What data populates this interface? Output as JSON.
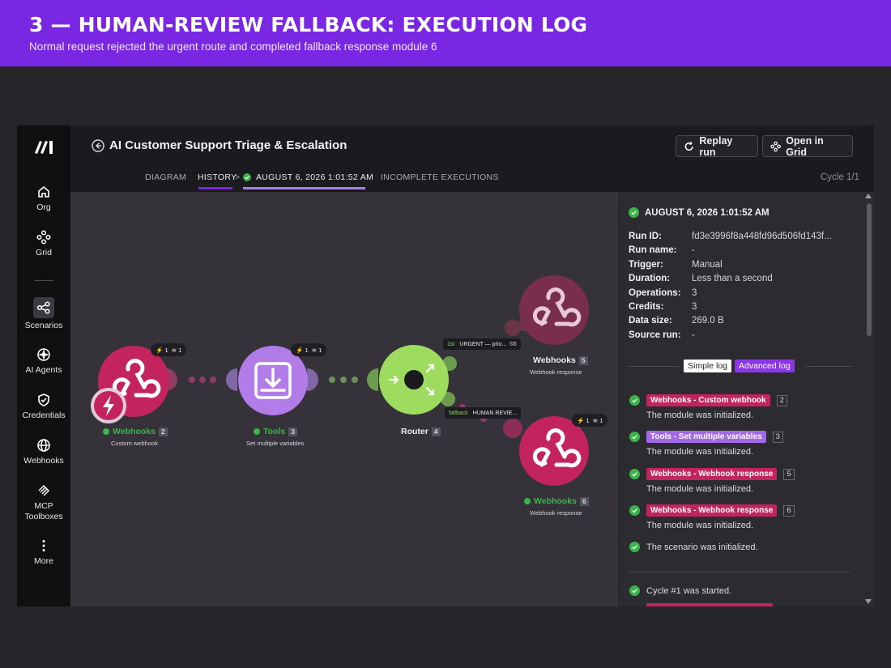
{
  "banner": {
    "title": "3 — HUMAN-REVIEW FALLBACK: EXECUTION LOG",
    "subtitle": "Normal request rejected the urgent route and completed fallback response module 6"
  },
  "sidebar": {
    "items": [
      {
        "label": "Org",
        "icon": "home-icon"
      },
      {
        "label": "Grid",
        "icon": "grid-icon"
      },
      {
        "label": "Scenarios",
        "icon": "share-nodes-icon",
        "active": true
      },
      {
        "label": "AI Agents",
        "icon": "ai-sparkle-icon"
      },
      {
        "label": "Credentials",
        "icon": "shield-check-icon"
      },
      {
        "label": "Webhooks",
        "icon": "globe-icon"
      },
      {
        "label": "MCP",
        "label2": "Toolboxes",
        "icon": "mcp-icon"
      },
      {
        "label": "More",
        "icon": "more-vertical-icon"
      }
    ]
  },
  "header": {
    "title": "AI Customer Support Triage & Escalation",
    "replay_label": "Replay run",
    "open_grid_label": "Open in Grid",
    "tabs": {
      "diagram": "DIAGRAM",
      "history": "HISTORY",
      "separator": ">",
      "run": "AUGUST 6, 2026 1:01:52 AM",
      "incomplete": "INCOMPLETE EXECUTIONS"
    },
    "cycle": "Cycle 1/1"
  },
  "canvas": {
    "modules": [
      {
        "name": "Webhooks",
        "num": "2",
        "sub": "Custom webhook",
        "ops": "1",
        "data": "1",
        "status": "ok"
      },
      {
        "name": "Tools",
        "num": "3",
        "sub": "Set multiple variables",
        "ops": "1",
        "data": "1",
        "status": "ok"
      },
      {
        "name": "Router",
        "num": "4"
      },
      {
        "name": "Webhooks",
        "num": "5",
        "sub": "Webhook response"
      },
      {
        "name": "Webhooks",
        "num": "6",
        "sub": "Webhook response",
        "ops": "1",
        "data": "1",
        "status": "ok"
      }
    ],
    "routes": [
      {
        "prefix": "1st",
        "label": "URGENT — prio...",
        "count": "0"
      },
      {
        "prefix": "fallback",
        "label": "HUMAN REVIE..."
      }
    ]
  },
  "panel": {
    "run_heading": "AUGUST 6, 2026 1:01:52 AM",
    "meta": [
      {
        "key": "Run ID:",
        "value": "fd3e3996f8a448fd96d506fd143f..."
      },
      {
        "key": "Run name:",
        "value": "-"
      },
      {
        "key": "Trigger:",
        "value": "Manual"
      },
      {
        "key": "Duration:",
        "value": "Less than a second"
      },
      {
        "key": "Operations:",
        "value": "3"
      },
      {
        "key": "Credits:",
        "value": "3"
      },
      {
        "key": "Data size:",
        "value": "269.0 B"
      },
      {
        "key": "Source run:",
        "value": "-"
      }
    ],
    "simple_log": "Simple log",
    "advanced_log": "Advanced log",
    "log": [
      {
        "badge": "Webhooks - Custom webhook",
        "num": "2",
        "text": "The module was initialized.",
        "kind": "hook"
      },
      {
        "badge": "Tools - Set multiple variables",
        "num": "3",
        "text": "The module was initialized.",
        "kind": "tools"
      },
      {
        "badge": "Webhooks - Webhook response",
        "num": "5",
        "text": "The module was initialized.",
        "kind": "hook"
      },
      {
        "badge": "Webhooks - Webhook response",
        "num": "6",
        "text": "The module was initialized.",
        "kind": "hook"
      }
    ],
    "scenario_init": "The scenario was initialized.",
    "cycle_started": "Cycle #1 was started."
  },
  "colors": {
    "accent": "#7a27e4",
    "webhook": "#c4245e",
    "tools": "#a368e8",
    "router": "#9ddc5f",
    "success": "#3bb54a"
  }
}
